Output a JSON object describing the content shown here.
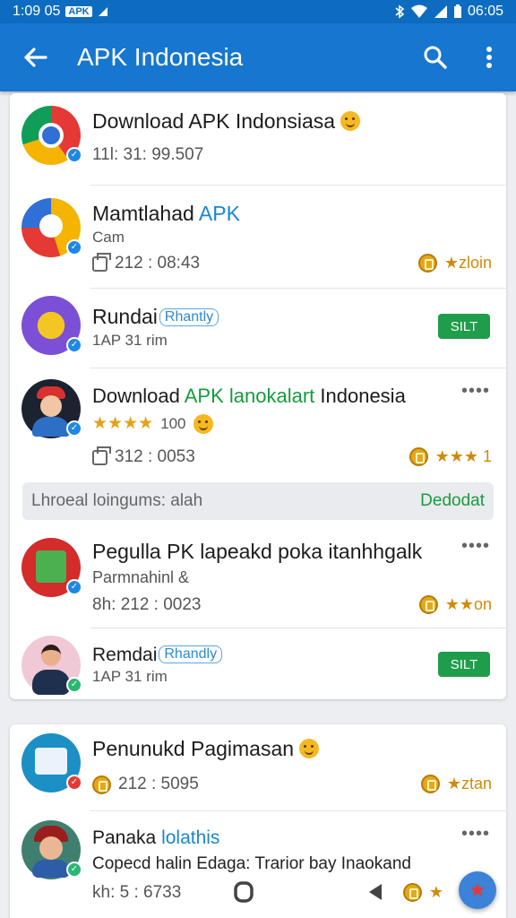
{
  "status_bar": {
    "time": "1:09 05",
    "box_label": "APK",
    "right_time": "06:05"
  },
  "app_bar": {
    "title": "APK Indonesia"
  },
  "items": [
    {
      "title": "Download APK Indonsiasa",
      "meta": "11l: 31: 99.507"
    },
    {
      "title_prefix": "Mamtlahad ",
      "title_accent": "APK",
      "sub": "Cam",
      "meta": "212 : 08:43",
      "rating": "★zloin"
    },
    {
      "title": "Rundai",
      "badge": "Rhantly",
      "sub": "1AP 31 rim",
      "action": "SILT"
    },
    {
      "title_prefix": "Download ",
      "title_accent": "APK lanokalart",
      "title_suffix": " Indonesia",
      "stars": "★★★★",
      "stars_count": "100",
      "meta": "312 : 0053",
      "rating": "★★★ 1"
    },
    {
      "title": "Pegulla PK lapeakd poka itanhhgalk",
      "sub": "Parmnahinl &",
      "meta": "8h: 212 : 0023",
      "rating": "★★on"
    },
    {
      "title": "Remdai",
      "badge": "Rhandly",
      "sub": "1AP 31 rim",
      "action": "SILT"
    },
    {
      "title": "Penunukd Pagimasan",
      "meta": "212 : 5095",
      "rating": "★ztan"
    },
    {
      "title_prefix": "Panaka ",
      "title_accent": "lolathis",
      "sub": "Copecd halin Edaga: Trarior bay Inaokand",
      "meta": "kh: 5 : 6733",
      "rating": "★"
    }
  ],
  "banner": {
    "left": "Lhroeal loingums: alah",
    "right": "Dedodat"
  },
  "colors": {
    "app_bar": "#1776cf",
    "accent_blue": "#1a86d0",
    "action_green": "#1f9d4a",
    "rating_gold": "#d08a0b"
  }
}
